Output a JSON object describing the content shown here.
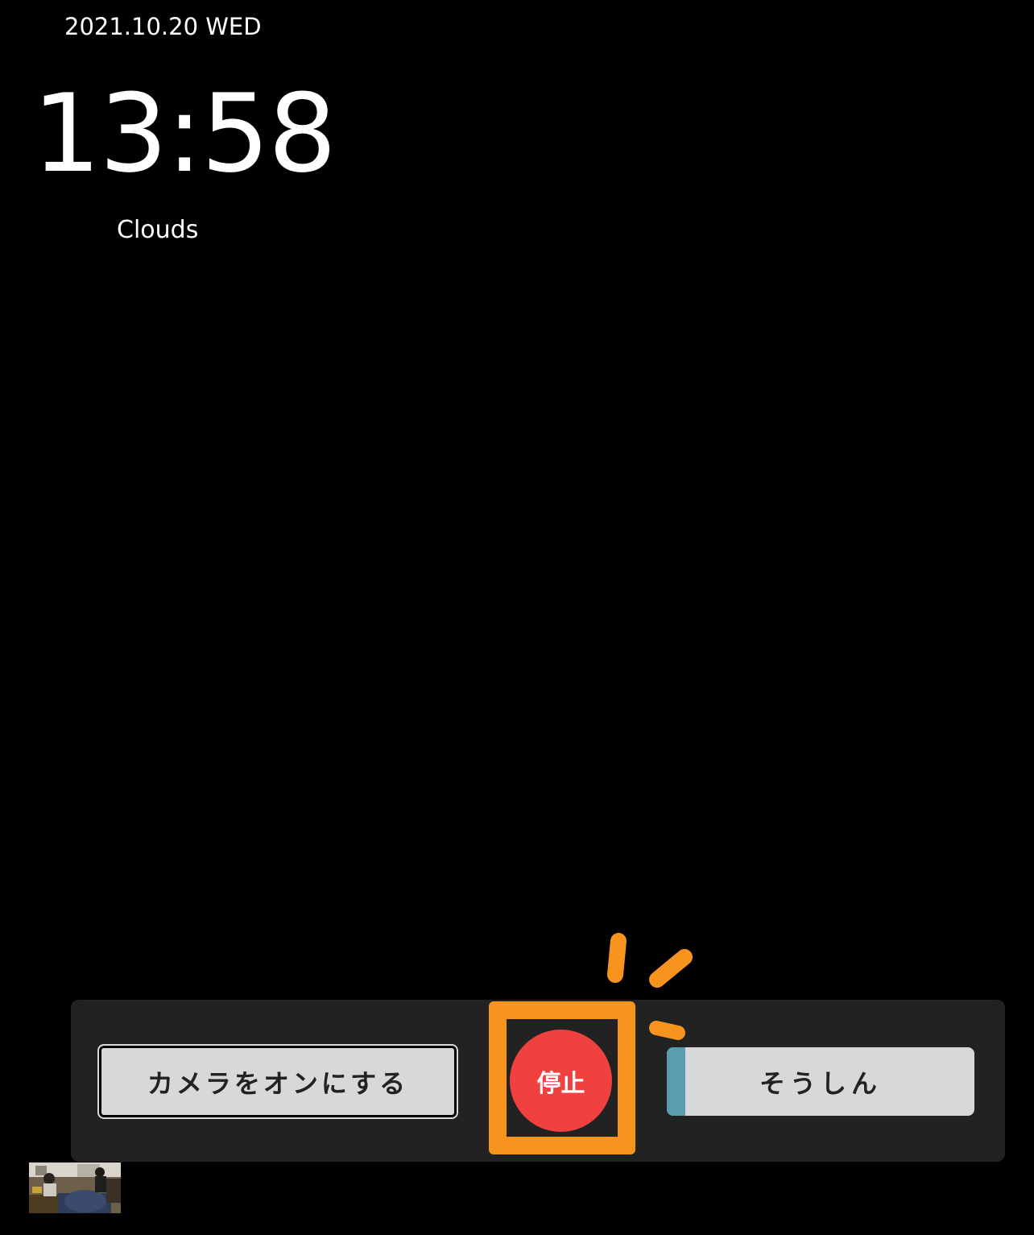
{
  "header": {
    "date": "2021.10.20 WED",
    "time": "13:58",
    "weather": "Clouds"
  },
  "controls": {
    "camera_button_label": "カメラをオンにする",
    "stop_button_label": "停止",
    "send_button_label": "そうしん",
    "send_progress": 0.06
  },
  "colors": {
    "background": "#000000",
    "bar": "#222222",
    "button_gray": "#d8d8d8",
    "stop_red": "#f04040",
    "highlight_orange": "#f7941d",
    "progress_teal": "#5b9db0"
  },
  "icons": {
    "highlight": "attention-burst-icon",
    "preview": "camera-preview-thumbnail"
  }
}
